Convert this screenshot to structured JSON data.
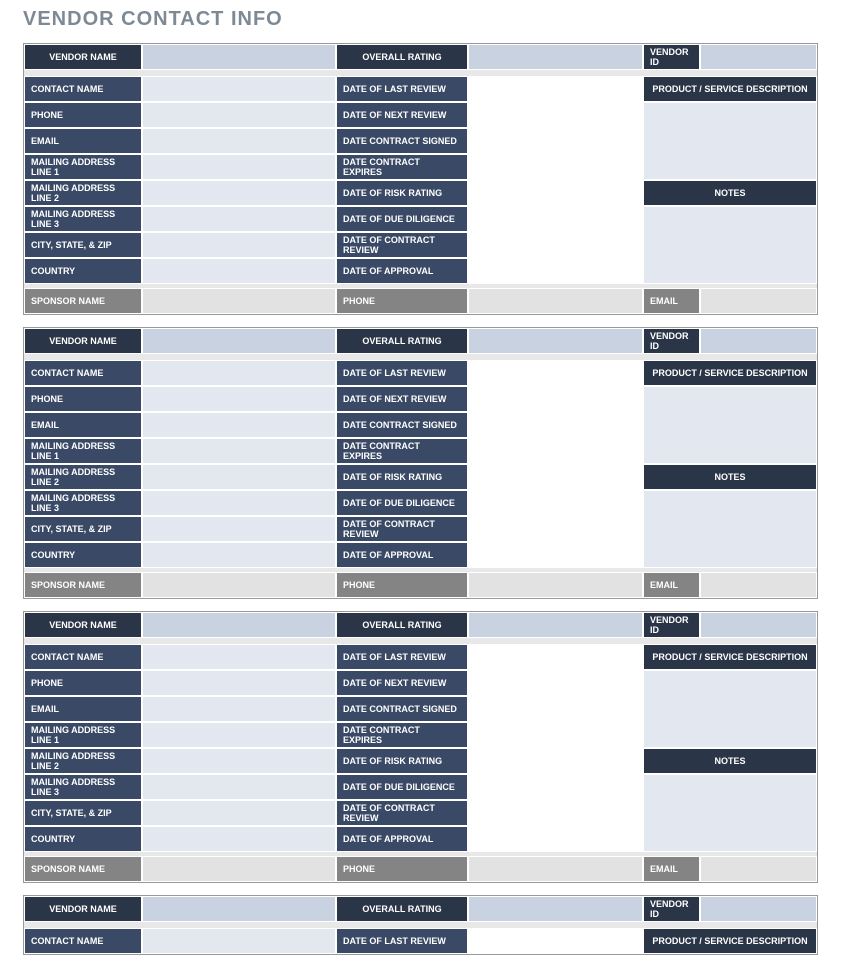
{
  "title": "VENDOR CONTACT INFO",
  "labels": {
    "vendor_name": "VENDOR NAME",
    "overall_rating": "OVERALL RATING",
    "vendor_id": "VENDOR ID",
    "contact_name": "CONTACT NAME",
    "date_last_review": "DATE OF LAST REVIEW",
    "product_desc": "PRODUCT / SERVICE DESCRIPTION",
    "phone": "PHONE",
    "date_next_review": "DATE OF NEXT REVIEW",
    "email": "EMAIL",
    "date_contract_signed": "DATE CONTRACT SIGNED",
    "mailing1": "MAILING ADDRESS LINE 1",
    "date_contract_expires": "DATE CONTRACT EXPIRES",
    "mailing2": "MAILING ADDRESS LINE 2",
    "date_risk_rating": "DATE OF RISK RATING",
    "notes": "NOTES",
    "mailing3": "MAILING ADDRESS LINE 3",
    "date_due_diligence": "DATE OF DUE DILIGENCE",
    "city_state_zip": "CITY, STATE, & ZIP",
    "date_contract_review": "DATE OF CONTRACT REVIEW",
    "country": "COUNTRY",
    "date_approval": "DATE OF APPROVAL",
    "sponsor_name": "SPONSOR NAME",
    "sponsor_phone": "PHONE",
    "sponsor_email": "EMAIL"
  },
  "vendors": [
    {
      "vendor_name": "",
      "overall_rating": "",
      "vendor_id": "",
      "contact_name": "",
      "date_last_review": "",
      "phone": "",
      "date_next_review": "",
      "email": "",
      "date_contract_signed": "",
      "mailing1": "",
      "date_contract_expires": "",
      "mailing2": "",
      "date_risk_rating": "",
      "mailing3": "",
      "date_due_diligence": "",
      "city_state_zip": "",
      "date_contract_review": "",
      "country": "",
      "date_approval": "",
      "sponsor_name": "",
      "sponsor_phone": "",
      "sponsor_email": "",
      "product_desc": "",
      "notes": ""
    },
    {
      "vendor_name": "",
      "overall_rating": "",
      "vendor_id": "",
      "contact_name": "",
      "date_last_review": "",
      "phone": "",
      "date_next_review": "",
      "email": "",
      "date_contract_signed": "",
      "mailing1": "",
      "date_contract_expires": "",
      "mailing2": "",
      "date_risk_rating": "",
      "mailing3": "",
      "date_due_diligence": "",
      "city_state_zip": "",
      "date_contract_review": "",
      "country": "",
      "date_approval": "",
      "sponsor_name": "",
      "sponsor_phone": "",
      "sponsor_email": "",
      "product_desc": "",
      "notes": ""
    },
    {
      "vendor_name": "",
      "overall_rating": "",
      "vendor_id": "",
      "contact_name": "",
      "date_last_review": "",
      "phone": "",
      "date_next_review": "",
      "email": "",
      "date_contract_signed": "",
      "mailing1": "",
      "date_contract_expires": "",
      "mailing2": "",
      "date_risk_rating": "",
      "mailing3": "",
      "date_due_diligence": "",
      "city_state_zip": "",
      "date_contract_review": "",
      "country": "",
      "date_approval": "",
      "sponsor_name": "",
      "sponsor_phone": "",
      "sponsor_email": "",
      "product_desc": "",
      "notes": ""
    },
    {
      "vendor_name": "",
      "overall_rating": "",
      "vendor_id": "",
      "contact_name": "",
      "date_last_review": "",
      "phone": "",
      "date_next_review": "",
      "email": "",
      "date_contract_signed": "",
      "mailing1": "",
      "date_contract_expires": "",
      "mailing2": "",
      "date_risk_rating": "",
      "mailing3": "",
      "date_due_diligence": "",
      "city_state_zip": "",
      "date_contract_review": "",
      "country": "",
      "date_approval": "",
      "sponsor_name": "",
      "sponsor_phone": "",
      "sponsor_email": "",
      "product_desc": "",
      "notes": ""
    }
  ]
}
